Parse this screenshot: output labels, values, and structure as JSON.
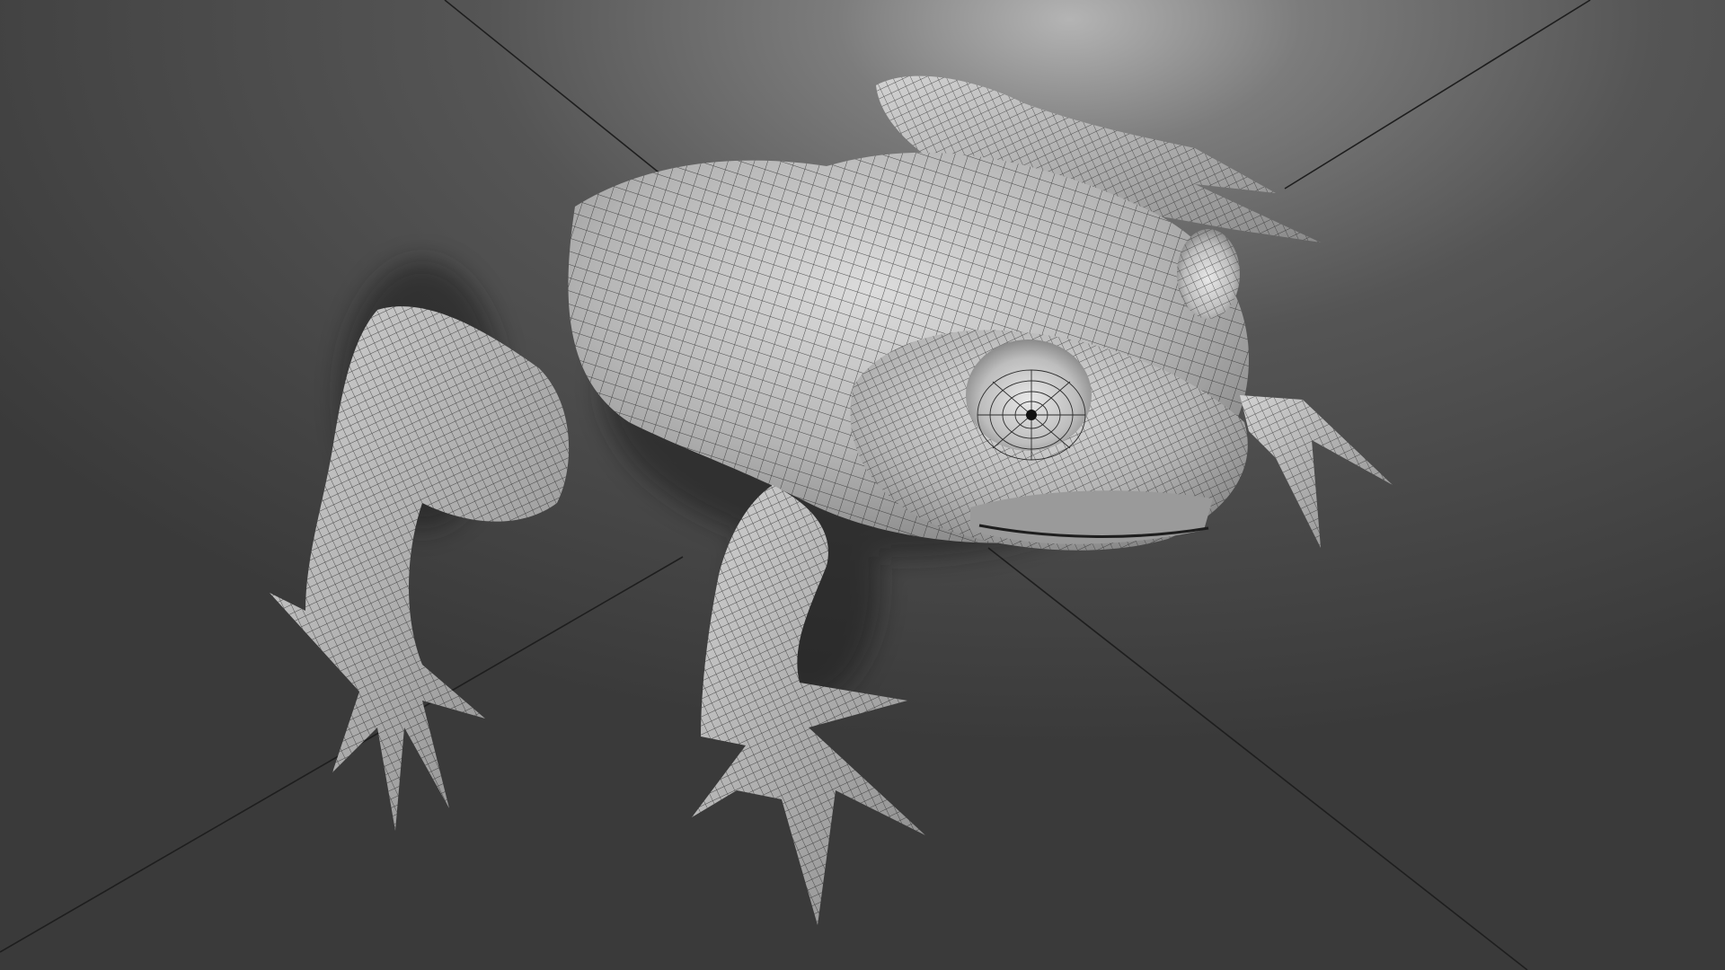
{
  "scene": {
    "subject": "frog-wireframe-render",
    "colors": {
      "background_dark": "#353535",
      "background_mid": "#4a4a4a",
      "highlight": "#a8a8a8",
      "surface": "#b9b9b9",
      "surface_light": "#d8d8d8",
      "surface_shadow": "#7a7a7a",
      "wire": "#2a2a2a",
      "edge_line": "#1f1f1f"
    }
  }
}
